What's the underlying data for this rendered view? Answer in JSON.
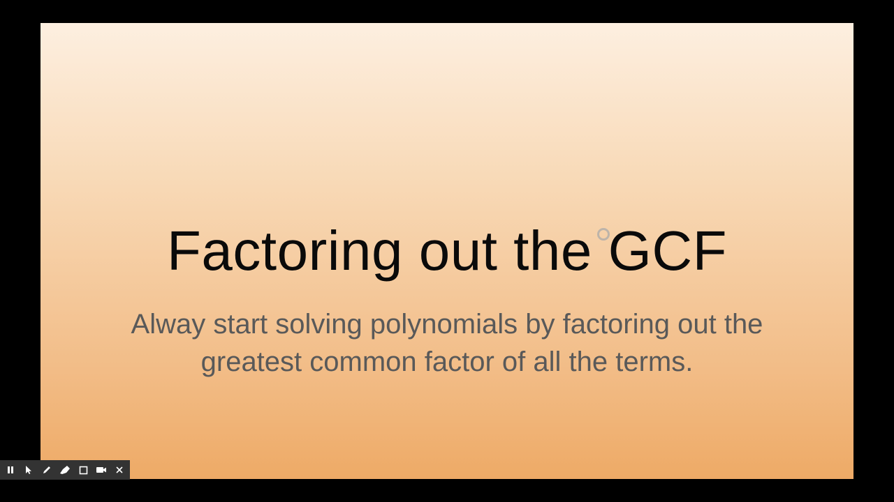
{
  "slide": {
    "title": "Factoring out the GCF",
    "subtitle": "Alway start solving polynomials by factoring out the greatest common factor of all the terms."
  },
  "toolbar": {
    "buttons": [
      {
        "name": "pause",
        "icon": "pause-icon"
      },
      {
        "name": "pointer",
        "icon": "cursor-icon"
      },
      {
        "name": "pen",
        "icon": "pen-icon"
      },
      {
        "name": "highlighter",
        "icon": "highlighter-icon"
      },
      {
        "name": "rectangle",
        "icon": "square-icon"
      },
      {
        "name": "camera",
        "icon": "video-camera-icon"
      },
      {
        "name": "close",
        "icon": "close-icon"
      }
    ]
  },
  "colors": {
    "title": "#0a0a0a",
    "subtitle": "#595959",
    "gradient_top": "#fdefe0",
    "gradient_bottom": "#eeaa66",
    "toolbar_bg": "#333333",
    "toolbar_icon": "#ffffff"
  }
}
